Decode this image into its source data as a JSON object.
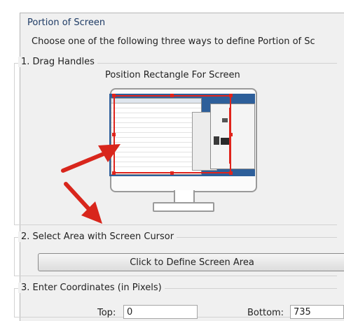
{
  "dialog": {
    "title": "Portion of Screen",
    "instructions": "Choose one of the following three ways to define Portion of Sc"
  },
  "section1": {
    "legend": "1. Drag Handles",
    "subtitle": "Position Rectangle For Screen"
  },
  "section2": {
    "legend": "2. Select Area with Screen Cursor",
    "button_label": "Click to Define Screen Area"
  },
  "section3": {
    "legend": "3. Enter Coordinates (in Pixels)",
    "top_label": "Top:",
    "top_value": "0",
    "bottom_label": "Bottom:",
    "bottom_value": "735"
  },
  "colors": {
    "selection": "#e0241c",
    "desktop": "#2e5f9a",
    "title_text": "#1d3a64"
  },
  "icons": [
    "monitor-icon",
    "arrow-icon"
  ]
}
